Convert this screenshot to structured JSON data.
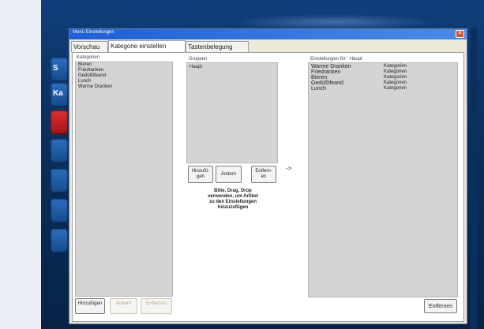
{
  "dialog": {
    "title": "Menü Einstellungen",
    "close_glyph": "✕",
    "tabs": [
      {
        "label": "Vorschau"
      },
      {
        "label": "Kategorie einstellen"
      },
      {
        "label": "Tastenbelegung"
      }
    ]
  },
  "sidebar_buttons": [
    {
      "label": "S"
    },
    {
      "label": "Ka"
    }
  ],
  "categories": {
    "label": "Kategorien",
    "items": [
      "Bieren",
      "Friedranken",
      "Gedüßtfeand",
      "Lunch",
      "Warme Dranken"
    ]
  },
  "groups": {
    "label": "Gruppen",
    "items": [
      "Haupt"
    ],
    "buttons": {
      "add": "Hinzufü-\ngen",
      "change": "Ändern",
      "remove": "Entfern-\nen"
    },
    "hint": "Bitte, Drag, Drop\nverwenden, um Artikel\nzu den Einstellungen\nhinzuzufügen"
  },
  "arrow": "->",
  "settings": {
    "label": "Einstellungen für : Haupt",
    "rows": [
      {
        "name": "Warme Dranken",
        "type": "Kategorien"
      },
      {
        "name": "Friedranken",
        "type": "Kategorien"
      },
      {
        "name": "Bieren",
        "type": "Kategorien"
      },
      {
        "name": "Gedüßtfeand",
        "type": "Kategorien"
      },
      {
        "name": "Lunch",
        "type": "Kategorien"
      }
    ],
    "remove_label": "Entfernen"
  },
  "bottom_buttons": {
    "add": "Hinzufügen",
    "edit": "Ändern",
    "remove": "Entfernen"
  }
}
